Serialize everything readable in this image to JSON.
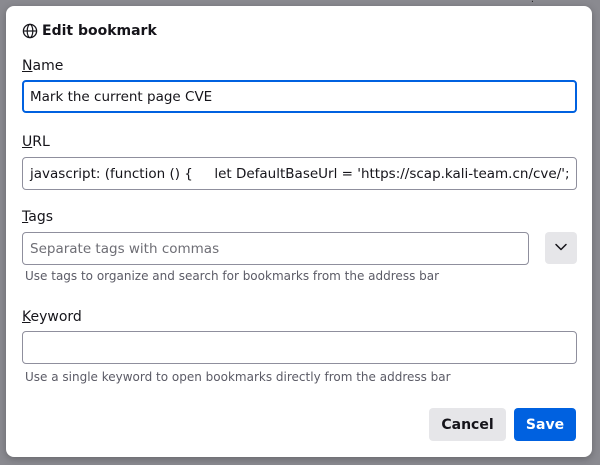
{
  "dialog": {
    "title": "Edit bookmark",
    "icon": "globe-icon"
  },
  "fields": {
    "name": {
      "label_accesskey": "N",
      "label_rest": "ame",
      "value": "Mark the current page CVE"
    },
    "url": {
      "label_accesskey": "U",
      "label_rest": "RL",
      "value": "javascript: (function () {     let DefaultBaseUrl = 'https://scap.kali-team.cn/cve/';     fur"
    },
    "tags": {
      "label_accesskey": "T",
      "label_rest": "ags",
      "placeholder": "Separate tags with commas",
      "help": "Use tags to organize and search for bookmarks from the address bar",
      "expander_icon": "chevron-down-icon"
    },
    "keyword": {
      "label_accesskey": "K",
      "label_rest": "eyword",
      "value": "",
      "help": "Use a single keyword to open bookmarks directly from the address bar"
    }
  },
  "buttons": {
    "cancel": "Cancel",
    "save": "Save"
  },
  "colors": {
    "accent": "#0061e0",
    "secondary_button": "#e6e6e9"
  }
}
